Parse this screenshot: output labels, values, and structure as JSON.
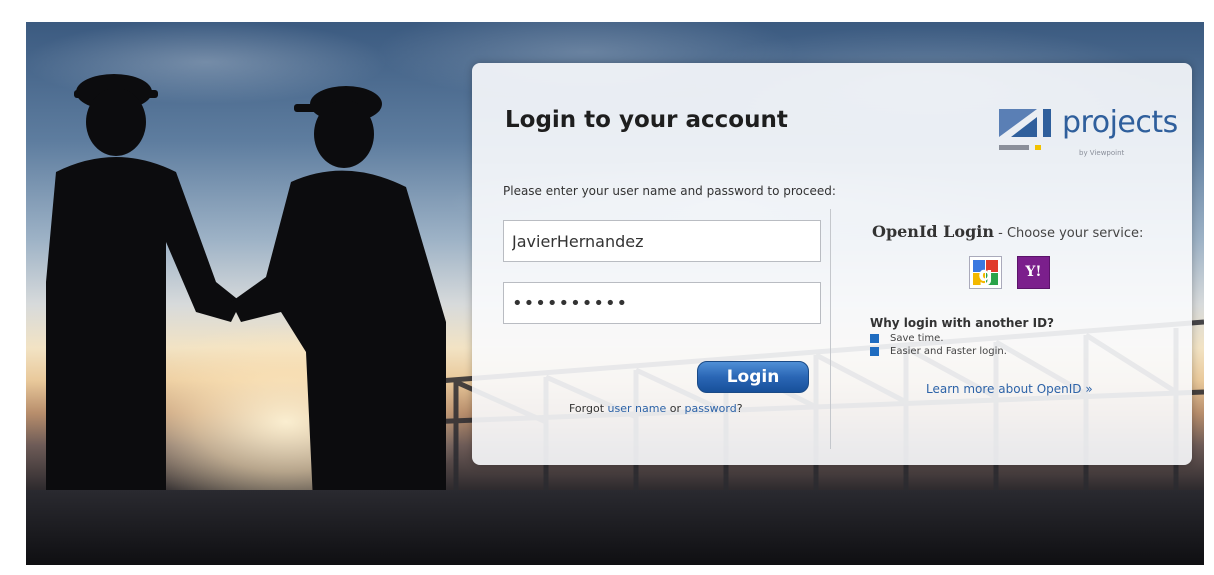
{
  "login": {
    "title": "Login to your account",
    "instructions": "Please enter your user name and password to proceed:",
    "username_value": "JavierHernandez",
    "password_value": "••••••••••",
    "button_label": "Login",
    "forgot_prefix": "Forgot ",
    "forgot_username_link": "user name",
    "forgot_or": " or ",
    "forgot_password_link": "password",
    "forgot_suffix": "?"
  },
  "logo": {
    "name": "projects",
    "byline": "by Viewpoint",
    "colors": {
      "blue": "#2f5f9c",
      "yellow": "#f2c200",
      "gray": "#8a8f9a"
    }
  },
  "openid": {
    "title": "OpenId Login",
    "subtitle": " - Choose your service:",
    "providers": [
      {
        "icon": "google-icon"
      },
      {
        "icon": "yahoo-icon",
        "glyph": "Y!"
      }
    ],
    "why_title": "Why login with another ID?",
    "reasons": [
      "Save time.",
      "Easier and Faster login."
    ],
    "learn_more": "Learn more about OpenID »"
  },
  "colors": {
    "accent": "#2a66b5",
    "link": "#2d63a8",
    "bullet": "#1f6cc0"
  }
}
